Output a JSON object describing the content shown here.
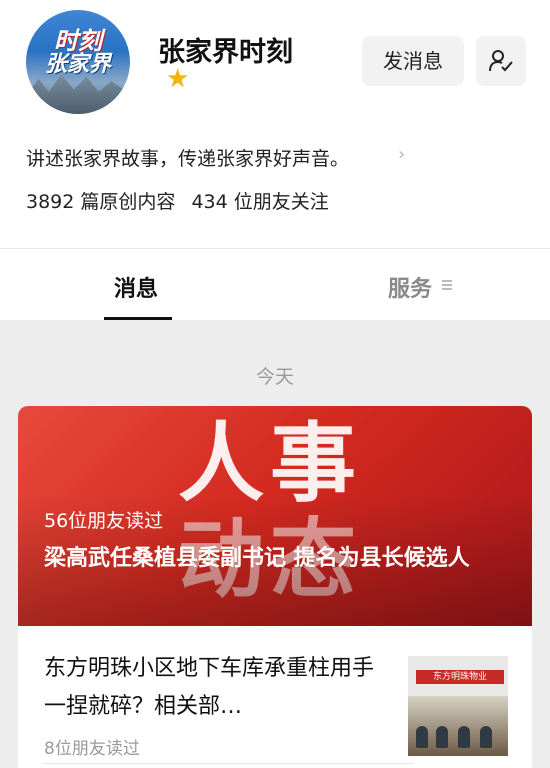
{
  "account": {
    "name": "张家界时刻",
    "avatar_text_line1": "时刻",
    "avatar_text_line2": "张家界",
    "description": "讲述张家界故事，传递张家界好声音。",
    "stats_articles": "3892 篇原创内容",
    "stats_followers": "434 位朋友关注",
    "send_message_label": "发消息"
  },
  "tabs": [
    {
      "label": "消息",
      "active": true
    },
    {
      "label": "服务",
      "active": false
    }
  ],
  "date_divider": "今天",
  "feed": {
    "hero": {
      "image_text_row1": "人事",
      "image_text_row2": "动态",
      "reads": "56位朋友读过",
      "title": "梁高武任桑植县委副书记 提名为县长候选人"
    },
    "article": {
      "title": "东方明珠小区地下车库承重柱用手一捏就碎？相关部…",
      "reads": "8位朋友读过",
      "thumb_banner": "东方明珠物业"
    }
  },
  "colors": {
    "hero_red": "#d42a20",
    "star": "#f5b400",
    "background": "#ededed"
  },
  "icons": [
    "star-icon",
    "follow-settings-icon",
    "chevron-right-icon",
    "menu-icon"
  ]
}
